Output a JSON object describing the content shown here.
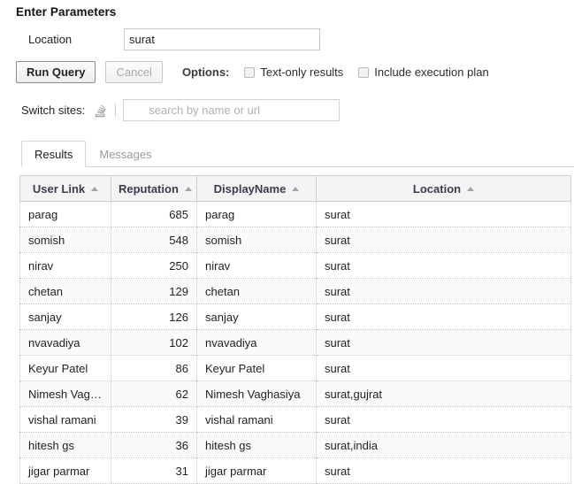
{
  "params": {
    "heading": "Enter Parameters",
    "location_label": "Location",
    "location_value": "surat",
    "location_placeholder": ""
  },
  "toolbar": {
    "run_label": "Run Query",
    "cancel_label": "Cancel",
    "options_label": "Options:",
    "text_only_label": "Text-only results",
    "exec_plan_label": "Include execution plan"
  },
  "switch_sites": {
    "label": "Switch sites:",
    "icon": "stackoverflow-icon",
    "search_value": "",
    "search_placeholder": "search by name or url"
  },
  "tabs": [
    {
      "label": "Results",
      "active": true
    },
    {
      "label": "Messages",
      "active": false
    }
  ],
  "table": {
    "columns": [
      {
        "label": "User Link",
        "sort": "asc",
        "align": "left"
      },
      {
        "label": "Reputation",
        "sort": "asc",
        "align": "right"
      },
      {
        "label": "DisplayName",
        "sort": "asc",
        "align": "left"
      },
      {
        "label": "Location",
        "sort": "asc",
        "align": "left"
      }
    ],
    "rows": [
      {
        "user_link": "parag",
        "reputation": "685",
        "display_name": "parag",
        "location": "surat"
      },
      {
        "user_link": "somish",
        "reputation": "548",
        "display_name": "somish",
        "location": "surat"
      },
      {
        "user_link": "nirav",
        "reputation": "250",
        "display_name": "nirav",
        "location": "surat"
      },
      {
        "user_link": "chetan",
        "reputation": "129",
        "display_name": "chetan",
        "location": "surat"
      },
      {
        "user_link": "sanjay",
        "reputation": "126",
        "display_name": "sanjay",
        "location": "surat"
      },
      {
        "user_link": "nvavadiya",
        "reputation": "102",
        "display_name": "nvavadiya",
        "location": "surat"
      },
      {
        "user_link": "Keyur Patel",
        "reputation": "86",
        "display_name": "Keyur Patel",
        "location": "surat"
      },
      {
        "user_link": "Nimesh Vag…",
        "reputation": "62",
        "display_name": "Nimesh Vaghasiya",
        "location": "surat,gujrat"
      },
      {
        "user_link": "vishal ramani",
        "reputation": "39",
        "display_name": "vishal ramani",
        "location": "surat"
      },
      {
        "user_link": "hitesh gs",
        "reputation": "36",
        "display_name": "hitesh gs",
        "location": "surat,india"
      },
      {
        "user_link": "jigar parmar",
        "reputation": "31",
        "display_name": "jigar parmar",
        "location": "surat"
      }
    ]
  },
  "colors": {
    "link": "#4a8fd0",
    "header_text": "#3b3b4d",
    "header_bg": "#f4f4f4",
    "border": "#cdcdcd",
    "row_alt_bg": "#fafafa"
  }
}
